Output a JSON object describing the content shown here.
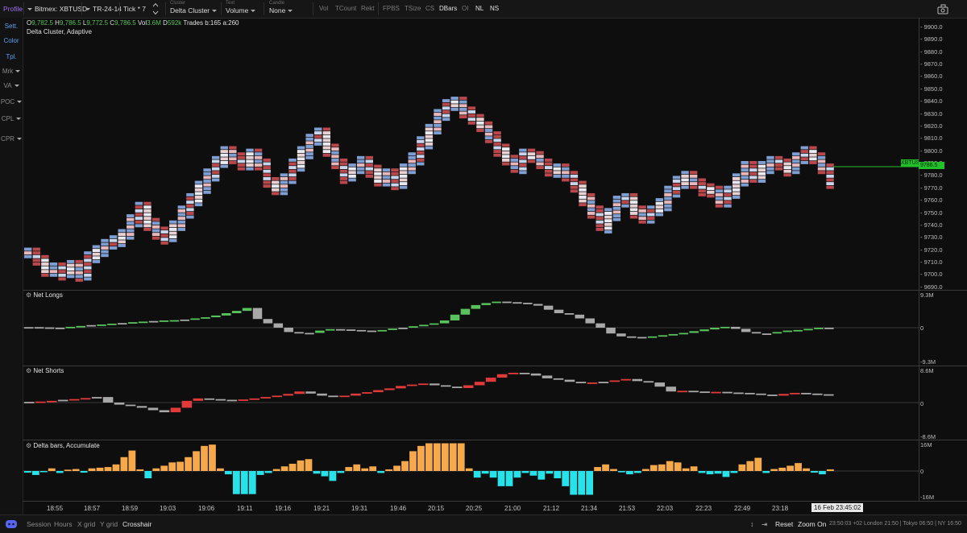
{
  "toolbar": {
    "profile_label": "Profile",
    "symbol": "Bitmex: XBTUSD",
    "timeframe": "TR-24-14",
    "tick": "Tick * 7",
    "cluster_caption": "Cluster",
    "cluster_value": "Delta Cluster",
    "text_caption": "Text",
    "text_value": "Volume",
    "candle_caption": "Candle",
    "candle_value": "None",
    "toggles": [
      "Vol",
      "TCount",
      "Rekt",
      "FPBS",
      "TSize",
      "CS",
      "DBars",
      "OI",
      "NL",
      "NS"
    ],
    "active_toggles": [
      "DBars",
      "NL",
      "NS"
    ]
  },
  "sidebar": {
    "items": [
      "Sett.",
      "Color",
      "Tpl.",
      "Mrk",
      "VA",
      "POC",
      "CPL",
      "CPR"
    ]
  },
  "info": {
    "o_label": "O",
    "o_value": "9,782.5",
    "h_label": "H",
    "h_value": "9,786.5",
    "l_label": "L",
    "l_value": "9,772.5",
    "c_label": "C",
    "c_value": "9,786.5",
    "vol_label": "Vol",
    "vol_value": "3.6M",
    "d_label": "D",
    "d_value": "592k",
    "trades_text": "Trades b:165 a:260",
    "indicator": "Delta Cluster, Adaptive"
  },
  "price_axis": {
    "ticks": [
      "9900.0",
      "9890.0",
      "9880.0",
      "9870.0",
      "9860.0",
      "9850.0",
      "9840.0",
      "9830.0",
      "9820.0",
      "9810.0",
      "9800.0",
      "9790.0",
      "9780.0",
      "9770.0",
      "9760.0",
      "9750.0",
      "9740.0",
      "9730.0",
      "9720.0",
      "9710.0",
      "9700.0",
      "9690.0"
    ],
    "symbol_badge": "XBTUSD",
    "last_price": "9786.5",
    "badge_color": "#22c02a"
  },
  "panels": {
    "net_longs": {
      "title": "Net Longs",
      "top": "9.3M",
      "mid": "0",
      "bottom": "-9.3M"
    },
    "net_shorts": {
      "title": "Net Shorts",
      "top": "8.6M",
      "mid": "0",
      "bottom": "-8.6M"
    },
    "delta": {
      "title": "Delta bars, Accumulate",
      "top": "16M",
      "mid": "0",
      "bottom": "-16M"
    }
  },
  "time_axis": {
    "ticks": [
      "18:55",
      "18:57",
      "18:59",
      "19:03",
      "19:06",
      "19:11",
      "19:16",
      "19:21",
      "19:31",
      "19:46",
      "20:15",
      "20:25",
      "21:00",
      "21:12",
      "21:34",
      "21:53",
      "22:03",
      "22:23",
      "22:49",
      "23:18"
    ],
    "cursor_label": "16 Feb  23:45:02"
  },
  "bottombar": {
    "left": [
      "Session",
      "Hours",
      "X grid",
      "Y grid",
      "Crosshair"
    ],
    "reset": "Reset",
    "zoom": "Zoom On",
    "clock": "23:50:03 +02  London 21:50 | Tokyo 06:50 | NY 16:50"
  },
  "colors": {
    "bull": "#58c25c",
    "bear": "#e23a3a",
    "neutral": "#a8a8a8",
    "delta_pos": "#f5a94b",
    "delta_neg": "#28e2ea",
    "cluster_blue": "#7f9ed2",
    "cluster_red": "#b8484c"
  },
  "chart_data": {
    "type": "bar",
    "price_close": [
      9718,
      9712,
      9705,
      9706,
      9702,
      9708,
      9700,
      9715,
      9720,
      9725,
      9728,
      9733,
      9745,
      9755,
      9742,
      9735,
      9731,
      9740,
      9752,
      9762,
      9772,
      9782,
      9792,
      9800,
      9795,
      9790,
      9798,
      9790,
      9775,
      9770,
      9778,
      9790,
      9800,
      9810,
      9815,
      9802,
      9790,
      9780,
      9786,
      9792,
      9785,
      9778,
      9782,
      9775,
      9786,
      9795,
      9808,
      9818,
      9830,
      9838,
      9840,
      9832,
      9826,
      9820,
      9812,
      9802,
      9793,
      9788,
      9798,
      9796,
      9790,
      9784,
      9786,
      9780,
      9772,
      9762,
      9752,
      9740,
      9750,
      9760,
      9762,
      9752,
      9748,
      9752,
      9758,
      9768,
      9776,
      9780,
      9774,
      9770,
      9768,
      9760,
      9768,
      9778,
      9788,
      9780,
      9788,
      9792,
      9790,
      9786,
      9795,
      9800,
      9795,
      9786,
      9775
    ],
    "net_longs": [
      0.2,
      0.1,
      0,
      0,
      0.3,
      0.6,
      0.9,
      1.1,
      1.4,
      1.6,
      1.9,
      2.1,
      2.3,
      2.5,
      2.6,
      2.8,
      3.2,
      3.6,
      4.2,
      5.0,
      5.8,
      6.8,
      3.0,
      1.5,
      0,
      -1.5,
      -2.0,
      -1.8,
      -1.0,
      -0.5,
      -0.6,
      -0.8,
      -1.0,
      -1.2,
      -0.8,
      -0.3,
      0,
      0.5,
      1.0,
      1.5,
      2.5,
      4.5,
      6.5,
      7.8,
      8.5,
      9.0,
      8.8,
      8.6,
      8.2,
      7.6,
      6.2,
      5.0,
      4.5,
      3.2,
      1.5,
      0,
      -2.0,
      -3.0,
      -3.2,
      -3.5,
      -3.0,
      -2.6,
      -2.2,
      -1.8,
      -1.2,
      -0.6,
      0,
      0.3,
      -0.4,
      -1.5,
      -2.0,
      -2.0,
      -1.5,
      -1.0,
      -0.8,
      -0.4,
      0,
      -0.5
    ],
    "net_shorts": [
      0.2,
      0.3,
      0.5,
      0.8,
      1.0,
      1.3,
      1.6,
      0,
      -0.6,
      -1.0,
      -1.5,
      -2.2,
      -2.8,
      -1.5,
      0.5,
      1.2,
      1.0,
      0.8,
      0.6,
      0.9,
      1.2,
      1.6,
      2.0,
      2.5,
      3.2,
      2.6,
      2.0,
      1.6,
      2.0,
      2.6,
      3.0,
      3.6,
      4.1,
      4.8,
      5.2,
      5.5,
      5.0,
      4.6,
      4.2,
      5.0,
      6.0,
      7.2,
      8.2,
      8.6,
      8.4,
      7.8,
      7.0,
      6.6,
      6.0,
      5.6,
      5.8,
      6.0,
      6.4,
      6.8,
      6.2,
      5.8,
      4.6,
      3.2,
      3.4,
      3.2,
      3.0,
      3.1,
      2.9,
      2.8,
      2.6,
      2.3,
      2.0,
      2.5,
      2.8,
      2.6,
      2.4,
      2.2
    ],
    "delta": [
      -0.5,
      -1.2,
      -0.3,
      0.8,
      -0.6,
      0.4,
      0.6,
      -0.5,
      0.8,
      1.0,
      1.2,
      2.0,
      4.2,
      6.2,
      0.5,
      -2.2,
      0.8,
      1.6,
      2.6,
      2.8,
      4.2,
      6.0,
      7.6,
      8.0,
      0.8,
      -1.0,
      -7.0,
      -7.0,
      -7.0,
      -1.2,
      -0.6,
      0.6,
      1.4,
      2.2,
      3.2,
      3.6,
      -0.8,
      -1.6,
      -3.0,
      -0.6,
      1.2,
      2.0,
      0.8,
      1.4,
      -0.6,
      0.5,
      1.6,
      3.0,
      6.0,
      7.6,
      8.4,
      8.4,
      8.4,
      8.4,
      8.4,
      0.8,
      -2.0,
      -0.8,
      -2.0,
      -4.6,
      -4.6,
      -2.0,
      -0.6,
      -1.4,
      -2.6,
      -0.8,
      -2.2,
      -4.6,
      -7.2,
      -7.2,
      -7.2,
      1.2,
      2.0,
      0.6,
      -0.4,
      -1.0,
      -0.6,
      0.6,
      1.8,
      2.0,
      3.0,
      2.6,
      0.8,
      1.4,
      -0.6,
      -1.0,
      -0.8,
      -1.8,
      -0.6,
      2.0,
      3.0,
      4.0,
      -0.6,
      0.6,
      1.0,
      1.6,
      2.4,
      0.8,
      -0.5,
      -1.0,
      0.5
    ]
  }
}
